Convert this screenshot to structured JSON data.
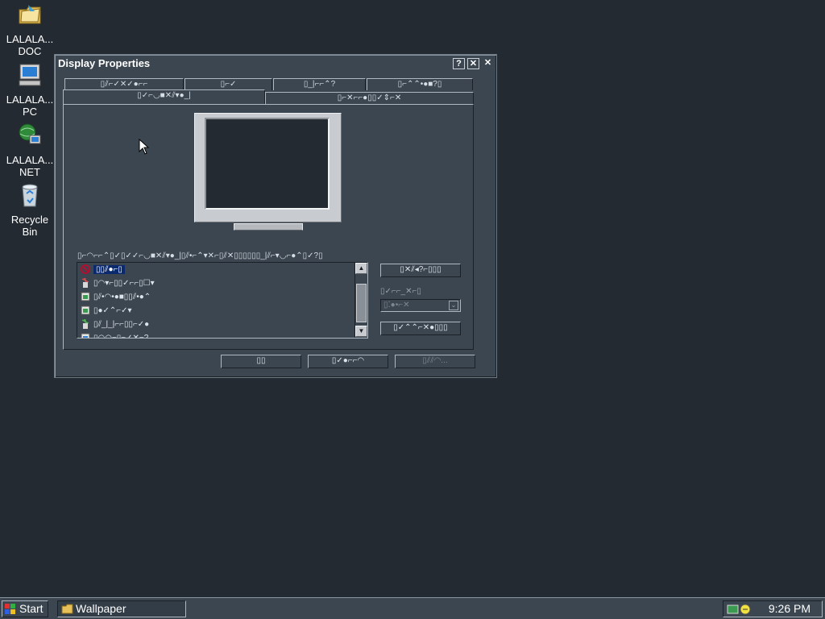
{
  "desktop": {
    "icons": [
      {
        "label": "LALALA...\nDOC",
        "icon": "folder-icon"
      },
      {
        "label": "LALALA...\nPC",
        "icon": "computer-icon"
      },
      {
        "label": "LALALA...\nNET",
        "icon": "network-icon"
      },
      {
        "label": "Recycle\nBin",
        "icon": "recycle-bin-icon"
      }
    ]
  },
  "window": {
    "title": "Display Properties",
    "help_glyph": "?",
    "close_glyph": "✕",
    "outer_close_glyph": "✕",
    "tabs_row1": [
      "▯⫽⌐✓✕✓●⌐⌐",
      "▯⌐✓",
      "▯_|⌐⌐⌃?",
      "▯⌐⌃⌃•●■?▯"
    ],
    "tabs_row2": [
      "▯✓⌐◡■✕⫽▾●_|",
      "▯⌐✕⌐⌐●▯▯✓⇕⌐✕"
    ],
    "list_caption": "▯⌐◠⌐⌐⌃▯✓▯✓✓⌐◡■✕⫽▾●_|▯⫽•⌐⌃▾✕⌐▯⫽✕▯▯▯▯▯▯_|⫽⌐▾◡⌐●⌃▯✓?▯",
    "list_items": [
      {
        "label": "▯▯⫽●⌐▯",
        "icon": "none-icon",
        "selected": true
      },
      {
        "label": "▯◠▾⌐▯▯✓⌐⌐▯☐▾",
        "icon": "paint-icon",
        "selected": false
      },
      {
        "label": "▯⫽•◠•●■▯▯⫽•●⌃",
        "icon": "image-icon",
        "selected": false
      },
      {
        "label": "▯●✓⌃⌐✓▾",
        "icon": "image-icon",
        "selected": false
      },
      {
        "label": "▯⫽_|_|⌐⌐▯▯⌐✓●",
        "icon": "paint-icon",
        "selected": false
      },
      {
        "label": "▯◠◠⌐▯⌐✓✕⌐?",
        "icon": "image-icon",
        "selected": false
      }
    ],
    "side_buttons": {
      "browse": "▯✕⫽◂?⌐▯▯▯",
      "pattern": "▯✓⌃⌃⌐✕●▯▯▯"
    },
    "display_group_label": "▯✓⌐⌐_✕⌐▯",
    "display_group_value": "▯⁚●•⌐✕",
    "dialog_buttons": {
      "ok": "▯▯",
      "cancel": "▯✓●⌐⌐◠",
      "apply": "▯⫽⫽◠..."
    }
  },
  "taskbar": {
    "start_label": "Start",
    "task_label": "Wallpaper",
    "clock": "9:26 PM"
  }
}
